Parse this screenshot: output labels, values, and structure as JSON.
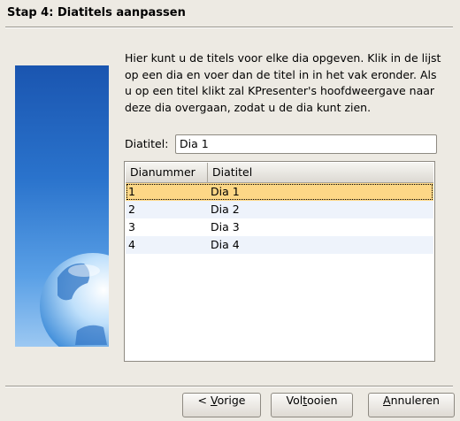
{
  "wizard": {
    "title": "Stap 4: Diatitels aanpassen",
    "description": "Hier kunt u de titels voor elke dia opgeven. Klik in de lijst op een dia en voer dan de titel in in het vak eronder. Als u op een titel klikt zal KPresenter's hoofdweergave naar deze dia overgaan, zodat u de dia kunt zien."
  },
  "field": {
    "label": "Diatitel:",
    "value": "Dia 1"
  },
  "table": {
    "headers": [
      "Dianummer",
      "Diatitel"
    ],
    "rows": [
      {
        "num": "1",
        "title": "Dia 1"
      },
      {
        "num": "2",
        "title": "Dia 2"
      },
      {
        "num": "3",
        "title": "Dia 3"
      },
      {
        "num": "4",
        "title": "Dia 4"
      }
    ],
    "selected_index": 0
  },
  "buttons": {
    "back_pre": "< ",
    "back_mn": "V",
    "back_post": "orige",
    "finish_pre": "Vol",
    "finish_mn": "t",
    "finish_post": "ooien",
    "cancel_pre": "",
    "cancel_mn": "A",
    "cancel_post": "nnuleren"
  },
  "colors": {
    "selection": "#fdd786",
    "alt_row": "#eef3fb",
    "sidebar_blue": "#2a73cc"
  }
}
